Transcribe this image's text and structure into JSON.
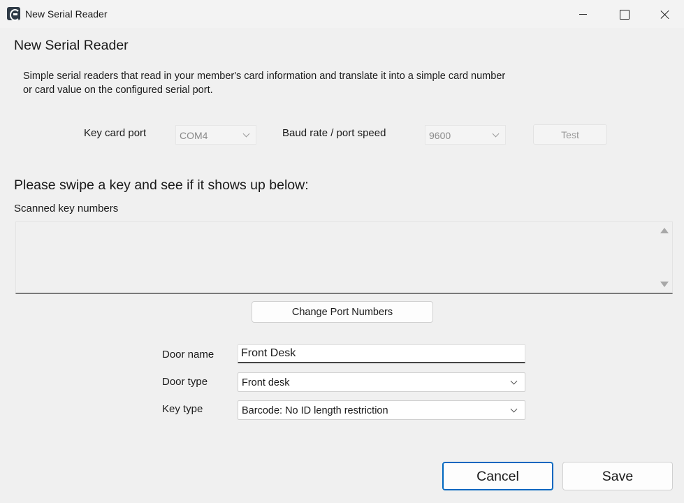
{
  "window": {
    "title": "New Serial Reader",
    "icon": "app-logo-icon"
  },
  "dialog": {
    "heading": "New Serial Reader",
    "description_line1": "Simple serial readers that read in your member's card information and translate it into a simple card number",
    "description_line2": "or card value on the configured serial port."
  },
  "port_settings": {
    "key_card_port_label": "Key card port",
    "key_card_port_value": "COM4",
    "baud_rate_label": "Baud rate / port speed",
    "baud_rate_value": "9600",
    "test_button": "Test"
  },
  "scan": {
    "prompt": "Please swipe a key and see if it shows up below:",
    "label": "Scanned key numbers",
    "content": ""
  },
  "change_port_button": "Change Port Numbers",
  "door": {
    "name_label": "Door name",
    "name_value": "Front Desk",
    "type_label": "Door type",
    "type_value": "Front desk",
    "key_type_label": "Key type",
    "key_type_value": "Barcode: No ID length restriction"
  },
  "actions": {
    "cancel": "Cancel",
    "save": "Save"
  },
  "colors": {
    "accent": "#0067c0",
    "background": "#f0f0f0"
  }
}
